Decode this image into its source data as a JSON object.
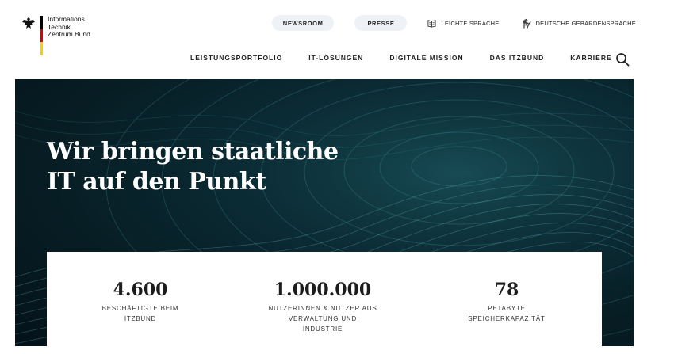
{
  "brand": {
    "line1": "Informations",
    "line2": "Technik",
    "line3": "Zentrum Bund"
  },
  "topbar": {
    "newsroom": "NEWSROOM",
    "presse": "PRESSE",
    "leichte_sprache": "LEICHTE SPRACHE",
    "gebaerdensprache": "DEUTSCHE GEBÄRDENSPRACHE"
  },
  "nav": {
    "items": [
      "LEISTUNGSPORTFOLIO",
      "IT-LÖSUNGEN",
      "DIGITALE MISSION",
      "DAS ITZBUND",
      "KARRIERE"
    ]
  },
  "hero": {
    "title_line1": "Wir bringen staatliche",
    "title_line2": "IT auf den Punkt"
  },
  "stats": [
    {
      "value": "4.600",
      "label_line1": "BESCHÄFTIGTE BEIM",
      "label_line2": "ITZBUND",
      "label_line3": ""
    },
    {
      "value": "1.000.000",
      "label_line1": "NUTZERINNEN & NUTZER AUS",
      "label_line2": "VERWALTUNG UND",
      "label_line3": "INDUSTRIE"
    },
    {
      "value": "78",
      "label_line1": "PETABYTE",
      "label_line2": "SPEICHERKAPAZITÄT",
      "label_line3": ""
    }
  ],
  "icons": {
    "eagle": "federal-eagle-icon",
    "leichte_sprache": "book-icon",
    "gebaerdensprache": "hands-icon",
    "search": "search-icon"
  },
  "colors": {
    "hero_bg": "#0a2a33",
    "pill_bg": "#eef1f6",
    "flag_black": "#000000",
    "flag_red": "#dd0000",
    "flag_gold": "#ffce00"
  }
}
